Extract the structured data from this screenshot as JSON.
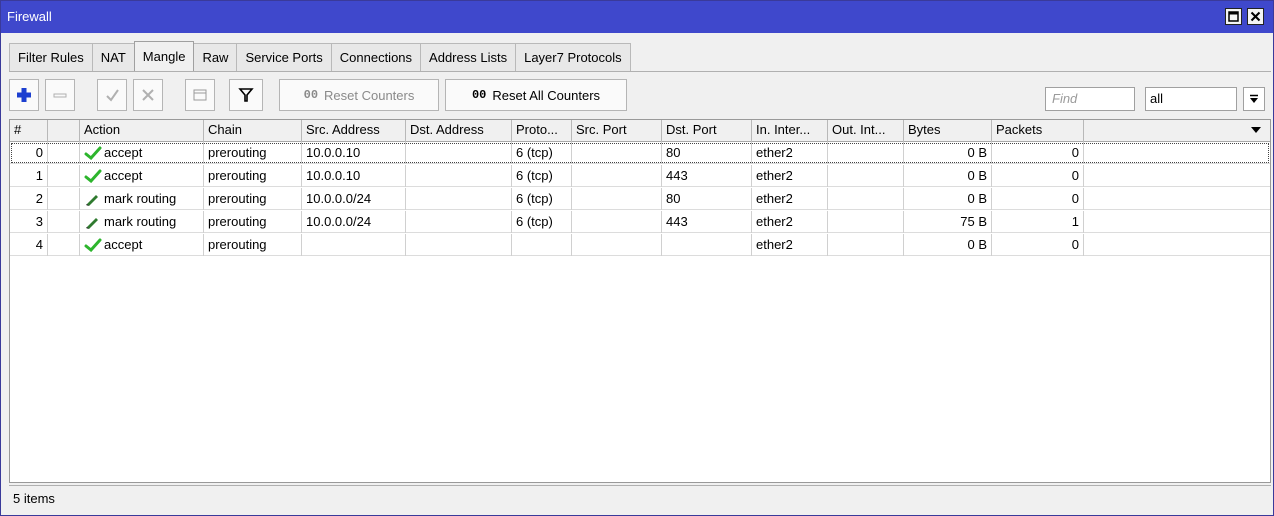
{
  "window": {
    "title": "Firewall"
  },
  "tabs": [
    {
      "label": "Filter Rules",
      "active": false
    },
    {
      "label": "NAT",
      "active": false
    },
    {
      "label": "Mangle",
      "active": true
    },
    {
      "label": "Raw",
      "active": false
    },
    {
      "label": "Service Ports",
      "active": false
    },
    {
      "label": "Connections",
      "active": false
    },
    {
      "label": "Address Lists",
      "active": false
    },
    {
      "label": "Layer7 Protocols",
      "active": false
    }
  ],
  "toolbar": {
    "add_icon": "plus-icon",
    "remove_icon": "minus-icon",
    "enable_icon": "check-icon",
    "disable_icon": "x-icon",
    "comment_icon": "comment-icon",
    "filter_icon": "funnel-icon",
    "reset_counters_prefix": "00",
    "reset_counters_label": "Reset Counters",
    "reset_all_prefix": "00",
    "reset_all_label": "Reset All Counters",
    "find_placeholder": "Find",
    "filter_value": "all"
  },
  "table": {
    "columns": [
      "#",
      "",
      "Action",
      "Chain",
      "Src. Address",
      "Dst. Address",
      "Proto...",
      "Src. Port",
      "Dst. Port",
      "In. Inter...",
      "Out. Int...",
      "Bytes",
      "Packets"
    ],
    "rows": [
      {
        "num": "0",
        "flag": "",
        "action": "accept",
        "action_icon": "check-icon",
        "chain": "prerouting",
        "src": "10.0.0.10",
        "dst": "",
        "proto": "6 (tcp)",
        "sport": "",
        "dport": "80",
        "in": "ether2",
        "out": "",
        "bytes": "0 B",
        "packets": "0"
      },
      {
        "num": "1",
        "flag": "",
        "action": "accept",
        "action_icon": "check-icon",
        "chain": "prerouting",
        "src": "10.0.0.10",
        "dst": "",
        "proto": "6 (tcp)",
        "sport": "",
        "dport": "443",
        "in": "ether2",
        "out": "",
        "bytes": "0 B",
        "packets": "0"
      },
      {
        "num": "2",
        "flag": "",
        "action": "mark routing",
        "action_icon": "pencil-icon",
        "chain": "prerouting",
        "src": "10.0.0.0/24",
        "dst": "",
        "proto": "6 (tcp)",
        "sport": "",
        "dport": "80",
        "in": "ether2",
        "out": "",
        "bytes": "0 B",
        "packets": "0"
      },
      {
        "num": "3",
        "flag": "",
        "action": "mark routing",
        "action_icon": "pencil-icon",
        "chain": "prerouting",
        "src": "10.0.0.0/24",
        "dst": "",
        "proto": "6 (tcp)",
        "sport": "",
        "dport": "443",
        "in": "ether2",
        "out": "",
        "bytes": "75 B",
        "packets": "1"
      },
      {
        "num": "4",
        "flag": "",
        "action": "accept",
        "action_icon": "check-icon",
        "chain": "prerouting",
        "src": "",
        "dst": "",
        "proto": "",
        "sport": "",
        "dport": "",
        "in": "ether2",
        "out": "",
        "bytes": "0 B",
        "packets": "0"
      }
    ]
  },
  "status": {
    "items_text": "5 items"
  },
  "colors": {
    "titlebar": "#3f48cc",
    "accept_green": "#2db52d",
    "add_blue": "#1c3fd0"
  }
}
